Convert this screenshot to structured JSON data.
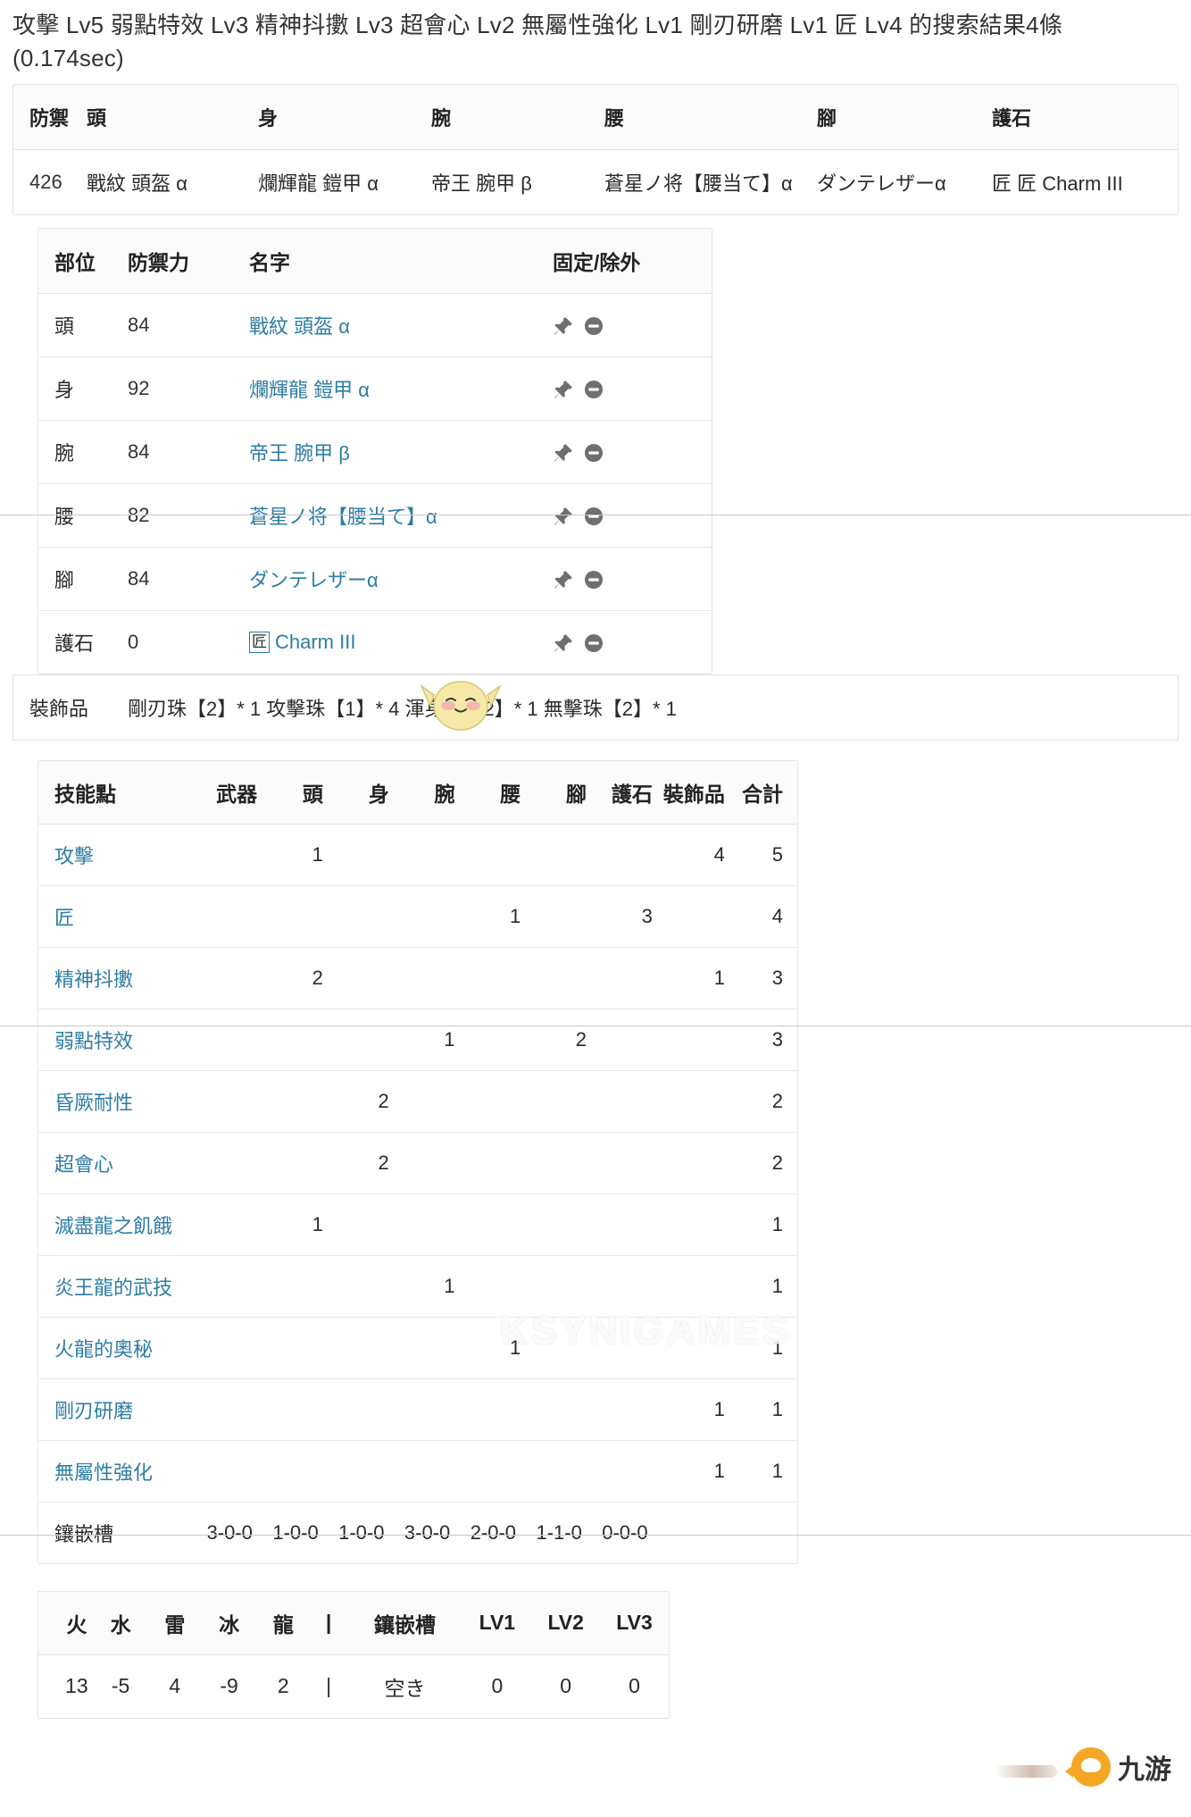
{
  "query": {
    "line1": "攻擊 Lv5 弱點特效 Lv3 精神抖擻 Lv3 超會心 Lv2 無屬性強化 Lv1 剛刃研磨 Lv1 匠 Lv4 的搜索結果4條",
    "line2": "(0.174sec)"
  },
  "summary": {
    "headers": [
      "防禦",
      "頭",
      "身",
      "腕",
      "腰",
      "腳",
      "護石"
    ],
    "row": {
      "defense": "426",
      "head": "戰紋 頭盔 α",
      "body": "爛輝龍 鎧甲 α",
      "arms": "帝王 腕甲 β",
      "waist": "蒼星ノ将【腰当て】α",
      "legs": "ダンテレザーα",
      "charm": "匠 Charm III",
      "charm_glyph": "匠"
    }
  },
  "pieces": {
    "headers": [
      "部位",
      "防禦力",
      "名字",
      "固定/除外"
    ],
    "rows": [
      {
        "part": "頭",
        "defense": "84",
        "name": "戰紋 頭盔 α",
        "glyph": ""
      },
      {
        "part": "身",
        "defense": "92",
        "name": "爛輝龍 鎧甲 α",
        "glyph": ""
      },
      {
        "part": "腕",
        "defense": "84",
        "name": "帝王 腕甲 β",
        "glyph": ""
      },
      {
        "part": "腰",
        "defense": "82",
        "name": "蒼星ノ将【腰当て】α",
        "glyph": ""
      },
      {
        "part": "腳",
        "defense": "84",
        "name": "ダンテレザーα",
        "glyph": ""
      },
      {
        "part": "護石",
        "defense": "0",
        "name": "Charm III",
        "glyph": "匠"
      }
    ],
    "pin_icon": "pin-icon",
    "exclude_icon": "minus-circle-icon"
  },
  "decorations": {
    "label": "裝飾品",
    "value": "剛刃珠【2】* 1 攻擊珠【1】* 4 渾身珠【2】* 1 無擊珠【2】* 1"
  },
  "skills": {
    "headers": [
      "技能點",
      "武器",
      "頭",
      "身",
      "腕",
      "腰",
      "腳",
      "護石",
      "裝飾品",
      "合計"
    ],
    "rows": [
      {
        "name": "攻擊",
        "weapon": "",
        "head": "1",
        "body": "",
        "arms": "",
        "waist": "",
        "legs": "",
        "charm": "",
        "deco": "4",
        "total": "5"
      },
      {
        "name": "匠",
        "weapon": "",
        "head": "",
        "body": "",
        "arms": "",
        "waist": "1",
        "legs": "",
        "charm": "3",
        "deco": "",
        "total": "4"
      },
      {
        "name": "精神抖擻",
        "weapon": "",
        "head": "2",
        "body": "",
        "arms": "",
        "waist": "",
        "legs": "",
        "charm": "",
        "deco": "1",
        "total": "3"
      },
      {
        "name": "弱點特效",
        "weapon": "",
        "head": "",
        "body": "",
        "arms": "1",
        "waist": "",
        "legs": "2",
        "charm": "",
        "deco": "",
        "total": "3"
      },
      {
        "name": "昏厥耐性",
        "weapon": "",
        "head": "",
        "body": "2",
        "arms": "",
        "waist": "",
        "legs": "",
        "charm": "",
        "deco": "",
        "total": "2"
      },
      {
        "name": "超會心",
        "weapon": "",
        "head": "",
        "body": "2",
        "arms": "",
        "waist": "",
        "legs": "",
        "charm": "",
        "deco": "",
        "total": "2"
      },
      {
        "name": "滅盡龍之飢餓",
        "weapon": "",
        "head": "1",
        "body": "",
        "arms": "",
        "waist": "",
        "legs": "",
        "charm": "",
        "deco": "",
        "total": "1"
      },
      {
        "name": "炎王龍的武技",
        "weapon": "",
        "head": "",
        "body": "",
        "arms": "1",
        "waist": "",
        "legs": "",
        "charm": "",
        "deco": "",
        "total": "1"
      },
      {
        "name": "火龍的奧秘",
        "weapon": "",
        "head": "",
        "body": "",
        "arms": "",
        "waist": "1",
        "legs": "",
        "charm": "",
        "deco": "",
        "total": "1"
      },
      {
        "name": "剛刃研磨",
        "weapon": "",
        "head": "",
        "body": "",
        "arms": "",
        "waist": "",
        "legs": "",
        "charm": "",
        "deco": "1",
        "total": "1"
      },
      {
        "name": "無屬性強化",
        "weapon": "",
        "head": "",
        "body": "",
        "arms": "",
        "waist": "",
        "legs": "",
        "charm": "",
        "deco": "1",
        "total": "1"
      }
    ],
    "slots_row": {
      "label": "鑲嵌槽",
      "values": [
        "3-0-0",
        "1-0-0",
        "1-0-0",
        "3-0-0",
        "2-0-0",
        "1-1-0",
        "0-0-0",
        "",
        ""
      ]
    }
  },
  "resistances": {
    "headers": [
      "火",
      "水",
      "雷",
      "冰",
      "龍",
      "|",
      "鑲嵌槽",
      "LV1",
      "LV2",
      "LV3"
    ],
    "values": [
      "13",
      "-5",
      "4",
      "-9",
      "2",
      "|",
      "空き",
      "0",
      "0",
      "0"
    ]
  },
  "branding": {
    "watermark": "KSYNIGAMES",
    "logo_text": "九游"
  },
  "colors": {
    "link": "#2d7da4",
    "text": "#2a2a2a",
    "border": "#e2e4e6",
    "header_bg": "#fbfbfc",
    "icon_gray": "#6f6f6f",
    "accent_orange": "#f5a623"
  }
}
